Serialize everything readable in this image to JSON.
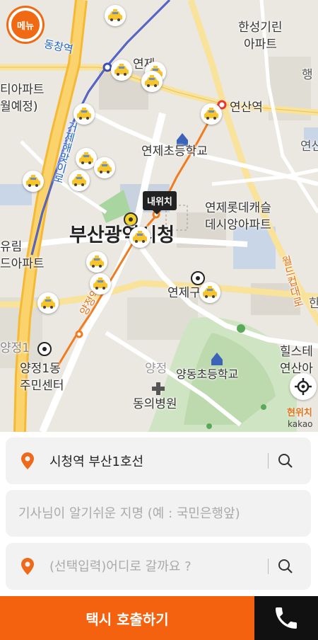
{
  "menu": {
    "label": "메뉴"
  },
  "map": {
    "labels": {
      "busan_city_hall": "부산광역시청",
      "yeonsan_station": "연산역",
      "yeonje_elementary": "연제초등학교",
      "yeonje_lotte_castle": "연제롯데캐슬",
      "desiang_apt": "데시앙아파트",
      "hanseong_kirin": "한성기린",
      "apt": "아파트",
      "tia_apt": "티아파트",
      "planned": "월예정)",
      "yurim": "유림",
      "drim_apt": "드아파트",
      "yeonje_office": "연제구청",
      "yangjeong1": "양정1동",
      "community_center": "주민센터",
      "yangdong_elementary": "양동초등학교",
      "dongui_hospital": "동의병원",
      "hills_yeonsan": "힐스테",
      "yeonsan_a": "연산아",
      "dongchang": "동창역",
      "yangjeong_st": "양정역",
      "yeonje": "연제",
      "haeng": "행",
      "yeonsan_r": "연산",
      "subway_1": "거제해맞이로",
      "subway_2": "월드컵대로",
      "yangjeong_top": "양정1",
      "yangjeong_mid": "양정",
      "han": "한"
    },
    "my_location_tag": "내위치",
    "locate_label": "현위치",
    "attribution": "kakao"
  },
  "form": {
    "origin": {
      "value": "시청역 부산1호선"
    },
    "landmark": {
      "placeholder": "기사님이 알기쉬운 지명 (예 : 국민은행앞)"
    },
    "destination": {
      "placeholder": "(선택입력)어디로 갈까요 ?"
    }
  },
  "actions": {
    "call_taxi": "택시 호출하기"
  },
  "colors": {
    "accent": "#f5620f",
    "pin": "#ee6a1b",
    "phone_bg": "#111111"
  }
}
